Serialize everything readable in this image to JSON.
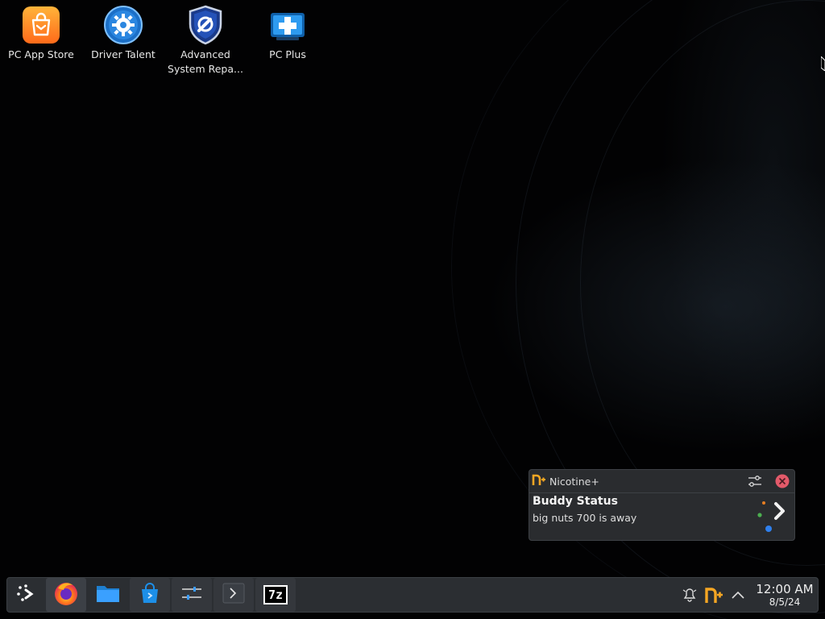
{
  "desktop": {
    "icons": [
      {
        "label": "PC App Store",
        "icon": "shopping-bag-icon"
      },
      {
        "label": "Driver Talent",
        "icon": "gear-icon"
      },
      {
        "label": "Advanced\nSystem Repa...",
        "icon": "shield-wrench-icon"
      },
      {
        "label": "PC Plus",
        "icon": "medical-cross-monitor-icon"
      }
    ]
  },
  "notification": {
    "app_name": "Nicotine+",
    "title": "Buddy Status",
    "body": "big nuts 700 is away",
    "icons": [
      "nicotine-icon",
      "configure-icon",
      "close-icon",
      "chevron-right-icon"
    ]
  },
  "taskbar": {
    "launchers": [
      {
        "name": "application-launcher",
        "icon": "kde-launcher-icon"
      },
      {
        "name": "firefox",
        "icon": "firefox-icon"
      },
      {
        "name": "dolphin-files",
        "icon": "folder-icon"
      },
      {
        "name": "discover-store",
        "icon": "shopping-bag-icon"
      },
      {
        "name": "system-settings",
        "icon": "settings-sliders-icon"
      },
      {
        "name": "terminal",
        "icon": "terminal-icon"
      },
      {
        "name": "7zip",
        "icon": "7z-icon",
        "text": "7z"
      }
    ],
    "tray": {
      "icons": [
        "notification-bell-icon",
        "nicotine-tray-icon",
        "show-hidden-icons-arrow-icon"
      ]
    },
    "clock": {
      "time": "12:00 AM",
      "date": "8/5/24"
    }
  },
  "colors": {
    "taskbar_bg": "#2b2e32",
    "notification_bg": "#2a2c2f",
    "accent_orange": "#f39c12",
    "desktop_bg": "#020203"
  }
}
